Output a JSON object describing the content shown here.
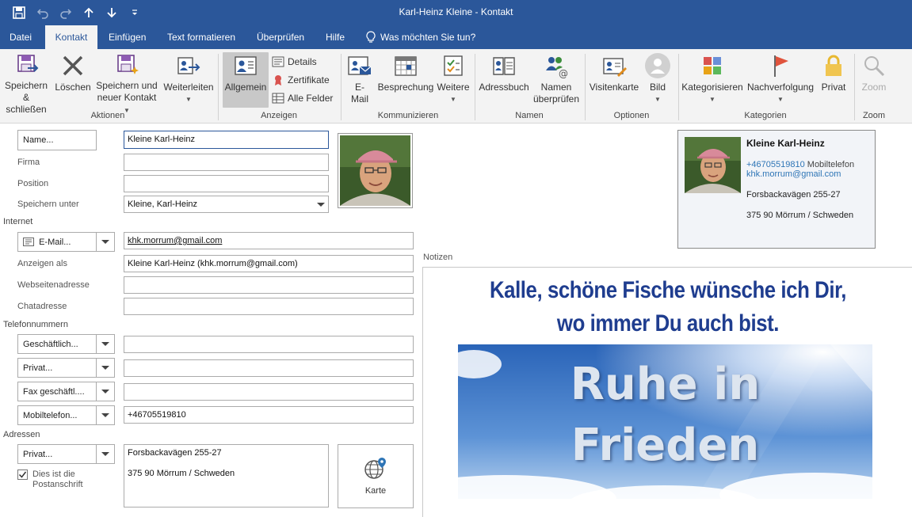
{
  "window": {
    "title": "Karl-Heinz Kleine  -  Kontakt"
  },
  "quick_access": {
    "save": "💾",
    "undo": "↶",
    "redo": "↷",
    "up": "↑",
    "down": "↓",
    "more": "⌄"
  },
  "menu": {
    "tabs": [
      "Datei",
      "Kontakt",
      "Einfügen",
      "Text formatieren",
      "Überprüfen",
      "Hilfe"
    ],
    "tellme": "Was möchten Sie tun?"
  },
  "ribbon": {
    "aktionen": {
      "save_close_1": "Speichern",
      "save_close_2": "& schließen",
      "delete": "Löschen",
      "save_new_1": "Speichern und",
      "save_new_2": "neuer Kontakt",
      "forward": "Weiterleiten",
      "label": "Aktionen"
    },
    "anzeigen": {
      "general": "Allgemein",
      "details": "Details",
      "certificates": "Zertifikate",
      "all_fields": "Alle Felder",
      "label": "Anzeigen"
    },
    "kommunizieren": {
      "email_1": "E-",
      "email_2": "Mail",
      "meeting": "Besprechung",
      "more": "Weitere",
      "label": "Kommunizieren"
    },
    "namen": {
      "address_book": "Adressbuch",
      "check_names_1": "Namen",
      "check_names_2": "überprüfen",
      "label": "Namen"
    },
    "optionen": {
      "business_card": "Visitenkarte",
      "picture": "Bild",
      "label": "Optionen"
    },
    "kategorien": {
      "categorize": "Kategorisieren",
      "followup": "Nachverfolgung",
      "private": "Privat",
      "label": "Kategorien"
    },
    "zoom": {
      "zoom": "Zoom",
      "label": "Zoom"
    }
  },
  "form": {
    "name_button": "Name...",
    "name_value": "Kleine Karl-Heinz",
    "company_label": "Firma",
    "company_value": "",
    "position_label": "Position",
    "position_value": "",
    "file_as_label": "Speichern unter",
    "file_as_value": "Kleine, Karl-Heinz",
    "internet_section": "Internet",
    "email_button": "E-Mail...",
    "email_value": "khk.morrum@gmail.com",
    "display_as_label": "Anzeigen als",
    "display_as_value": "Kleine Karl-Heinz (khk.morrum@gmail.com)",
    "web_label": "Webseitenadresse",
    "web_value": "",
    "chat_label": "Chatadresse",
    "chat_value": "",
    "phone_section": "Telefonnummern",
    "phone_business_button": "Geschäftlich...",
    "phone_business_value": "",
    "phone_private_button": "Privat...",
    "phone_private_value": "",
    "fax_button": "Fax geschäftl....",
    "fax_value": "",
    "mobile_button": "Mobiltelefon...",
    "mobile_value": "+46705519810",
    "address_section": "Adressen",
    "address_button": "Privat...",
    "address_line1": "Forsbackavägen 255-27",
    "address_line2": "375 90 Mörrum / Schweden",
    "postal_checkbox_1": "Dies ist die",
    "postal_checkbox_2": "Postanschrift",
    "postal_checked": true,
    "map_button": "Karte"
  },
  "card": {
    "name": "Kleine Karl-Heinz",
    "phone": "+46705519810",
    "phone_type": "Mobiltelefon",
    "email": "khk.morrum@gmail.com",
    "address_line1": "Forsbackavägen 255-27",
    "address_line2": "375 90 Mörrum / Schweden"
  },
  "notes": {
    "label": "Notizen",
    "line1": "Kalle, schöne Fische wünsche ich Dir,",
    "line2": "wo immer Du auch bist.",
    "image_line1": "Ruhe in",
    "image_line2": "Frieden"
  },
  "colors": {
    "accent": "#2b579a",
    "ribbon_bg": "#f3f3f3",
    "notes_text": "#1f3d8f",
    "link": "#2e75b6"
  }
}
